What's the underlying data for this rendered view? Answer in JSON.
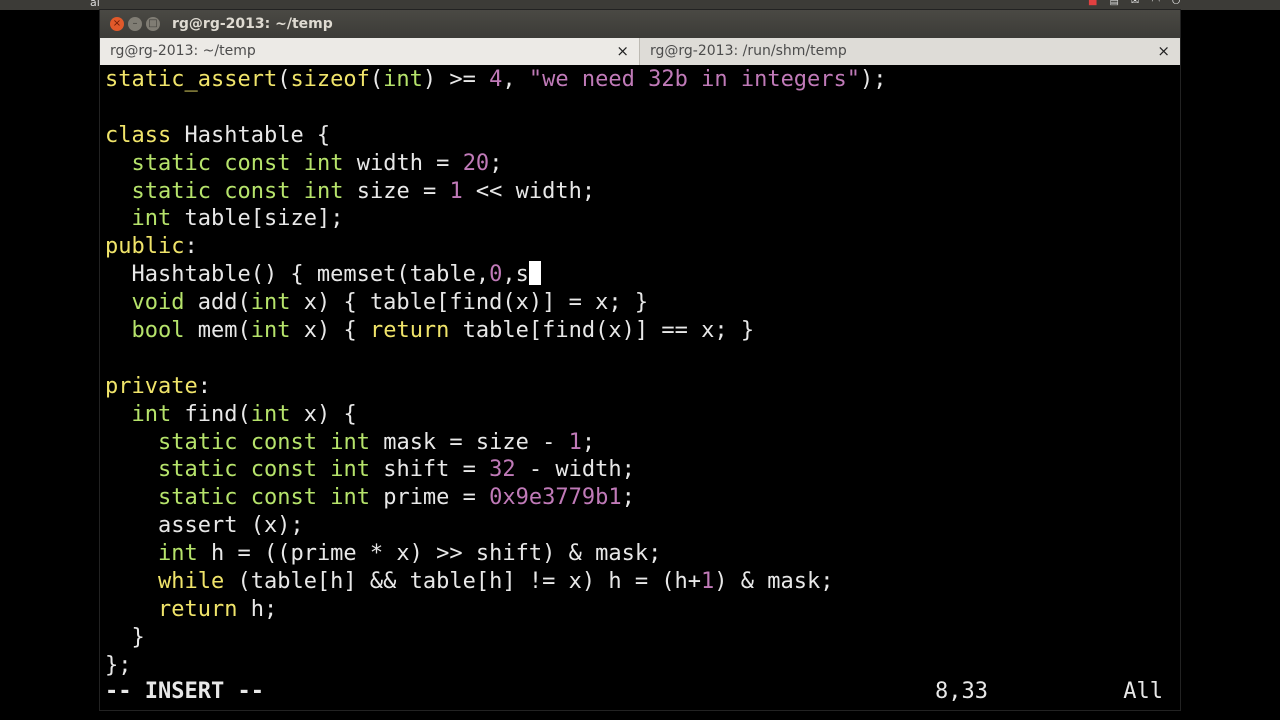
{
  "topbar": {
    "label": "al",
    "icons": [
      "battery-icon",
      "keyboard-icon",
      "mail-icon",
      "wifi-icon",
      "power-icon"
    ]
  },
  "window": {
    "title": "rg@rg-2013: ~/temp",
    "buttons": [
      "close",
      "minimize",
      "maximize"
    ]
  },
  "tabs": [
    {
      "label": "rg@rg-2013: ~/temp",
      "close": "×"
    },
    {
      "label": "rg@rg-2013: /run/shm/temp",
      "close": "×"
    }
  ],
  "colors": {
    "keyword": "#f0e46a",
    "type": "#b6e36b",
    "number": "#c07ab8",
    "string": "#c07ab8",
    "text": "#e8e8e8",
    "background": "#000000"
  },
  "code": {
    "lines": [
      [
        [
          "kw",
          "static_assert"
        ],
        [
          "p",
          "("
        ],
        [
          "kw",
          "sizeof"
        ],
        [
          "p",
          "("
        ],
        [
          "type",
          "int"
        ],
        [
          "p",
          ") >= "
        ],
        [
          "num",
          "4"
        ],
        [
          "p",
          ", "
        ],
        [
          "str",
          "\"we need 32b in integers\""
        ],
        [
          "p",
          ");"
        ]
      ],
      [],
      [
        [
          "kw",
          "class"
        ],
        [
          "p",
          " Hashtable {"
        ]
      ],
      [
        [
          "p",
          "  "
        ],
        [
          "type",
          "static"
        ],
        [
          "p",
          " "
        ],
        [
          "type",
          "const"
        ],
        [
          "p",
          " "
        ],
        [
          "type",
          "int"
        ],
        [
          "p",
          " width = "
        ],
        [
          "num",
          "20"
        ],
        [
          "p",
          ";"
        ]
      ],
      [
        [
          "p",
          "  "
        ],
        [
          "type",
          "static"
        ],
        [
          "p",
          " "
        ],
        [
          "type",
          "const"
        ],
        [
          "p",
          " "
        ],
        [
          "type",
          "int"
        ],
        [
          "p",
          " size = "
        ],
        [
          "num",
          "1"
        ],
        [
          "p",
          " << width;"
        ]
      ],
      [
        [
          "p",
          "  "
        ],
        [
          "type",
          "int"
        ],
        [
          "p",
          " table[size];"
        ]
      ],
      [
        [
          "kw",
          "public"
        ],
        [
          "p",
          ":"
        ]
      ],
      [
        [
          "p",
          "  Hashtable() { memset(table,"
        ],
        [
          "num",
          "0"
        ],
        [
          "p",
          ",s"
        ]
      ],
      [
        [
          "p",
          "  "
        ],
        [
          "type",
          "void"
        ],
        [
          "p",
          " add("
        ],
        [
          "type",
          "int"
        ],
        [
          "p",
          " x) { table[find(x)] = x; }"
        ]
      ],
      [
        [
          "p",
          "  "
        ],
        [
          "type",
          "bool"
        ],
        [
          "p",
          " mem("
        ],
        [
          "type",
          "int"
        ],
        [
          "p",
          " x) { "
        ],
        [
          "kw",
          "return"
        ],
        [
          "p",
          " table[find(x)] == x; }"
        ]
      ],
      [],
      [
        [
          "kw",
          "private"
        ],
        [
          "p",
          ":"
        ]
      ],
      [
        [
          "p",
          "  "
        ],
        [
          "type",
          "int"
        ],
        [
          "p",
          " find("
        ],
        [
          "type",
          "int"
        ],
        [
          "p",
          " x) {"
        ]
      ],
      [
        [
          "p",
          "    "
        ],
        [
          "type",
          "static"
        ],
        [
          "p",
          " "
        ],
        [
          "type",
          "const"
        ],
        [
          "p",
          " "
        ],
        [
          "type",
          "int"
        ],
        [
          "p",
          " mask = size - "
        ],
        [
          "num",
          "1"
        ],
        [
          "p",
          ";"
        ]
      ],
      [
        [
          "p",
          "    "
        ],
        [
          "type",
          "static"
        ],
        [
          "p",
          " "
        ],
        [
          "type",
          "const"
        ],
        [
          "p",
          " "
        ],
        [
          "type",
          "int"
        ],
        [
          "p",
          " shift = "
        ],
        [
          "num",
          "32"
        ],
        [
          "p",
          " - width;"
        ]
      ],
      [
        [
          "p",
          "    "
        ],
        [
          "type",
          "static"
        ],
        [
          "p",
          " "
        ],
        [
          "type",
          "const"
        ],
        [
          "p",
          " "
        ],
        [
          "type",
          "int"
        ],
        [
          "p",
          " prime = "
        ],
        [
          "num",
          "0x9e3779b1"
        ],
        [
          "p",
          ";"
        ]
      ],
      [
        [
          "p",
          "    assert (x);"
        ]
      ],
      [
        [
          "p",
          "    "
        ],
        [
          "type",
          "int"
        ],
        [
          "p",
          " h = ((prime * x) >> shift) & mask;"
        ]
      ],
      [
        [
          "p",
          "    "
        ],
        [
          "kw",
          "while"
        ],
        [
          "p",
          " (table[h] && table[h] != x) h = (h+"
        ],
        [
          "num",
          "1"
        ],
        [
          "p",
          ") & mask;"
        ]
      ],
      [
        [
          "p",
          "    "
        ],
        [
          "kw",
          "return"
        ],
        [
          "p",
          " h;"
        ]
      ],
      [
        [
          "p",
          "  }"
        ]
      ],
      [
        [
          "p",
          "};"
        ]
      ]
    ],
    "cursor_line": 7
  },
  "status": {
    "mode": "-- INSERT --",
    "position": "8,33",
    "scroll": "All"
  }
}
